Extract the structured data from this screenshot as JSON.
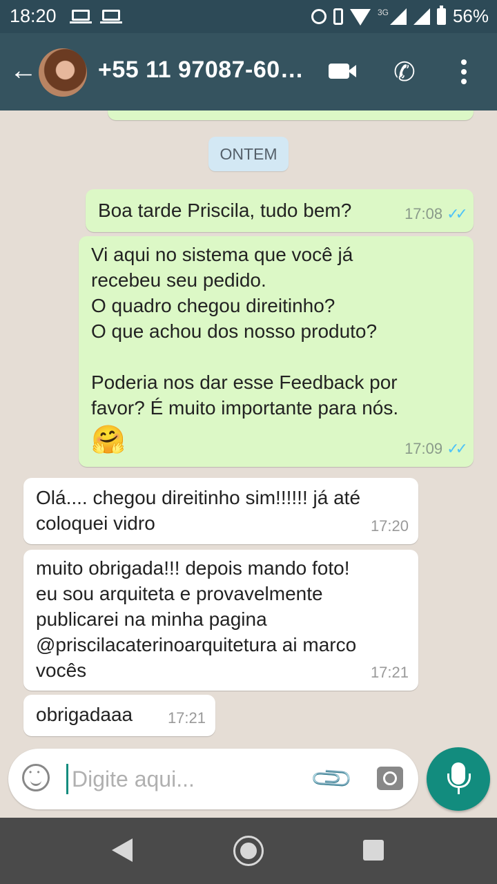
{
  "status_bar": {
    "time": "18:20",
    "network": "3G",
    "battery": "56%"
  },
  "header": {
    "contact": "+55 11 97087-60…"
  },
  "chat": {
    "date_chip": "ONTEM",
    "messages": [
      {
        "direction": "out",
        "lines": [
          "Boa tarde Priscila, tudo bem?"
        ],
        "time": "17:08",
        "ticks": "✓✓"
      },
      {
        "direction": "out",
        "lines": [
          "Vi aqui no sistema que você já",
          "recebeu seu pedido.",
          "O quadro chegou direitinho?",
          "O que achou dos nosso produto?",
          "",
          "Poderia nos dar esse Feedback por",
          "favor? É muito importante para nós."
        ],
        "emoji": "🤗",
        "time": "17:09",
        "ticks": "✓✓"
      },
      {
        "direction": "in",
        "lines": [
          "Olá.... chegou direitinho sim!!!!!! já até",
          "coloquei vidro"
        ],
        "time": "17:20"
      },
      {
        "direction": "in",
        "lines": [
          "muito obrigada!!! depois mando foto!",
          "eu sou arquiteta e provavelmente",
          "publicarei na minha pagina",
          "@priscilacaterinoarquitetura ai marco",
          "vocês"
        ],
        "time": "17:21"
      },
      {
        "direction": "in",
        "lines": [
          "obrigadaaa"
        ],
        "time": "17:21"
      }
    ]
  },
  "composer": {
    "placeholder": "Digite aqui..."
  },
  "colors": {
    "header": "#35535f",
    "outgoing_bubble": "#dcf8c6",
    "incoming_bubble": "#ffffff",
    "accent": "#128c7e",
    "read_ticks": "#4fc3f7"
  }
}
